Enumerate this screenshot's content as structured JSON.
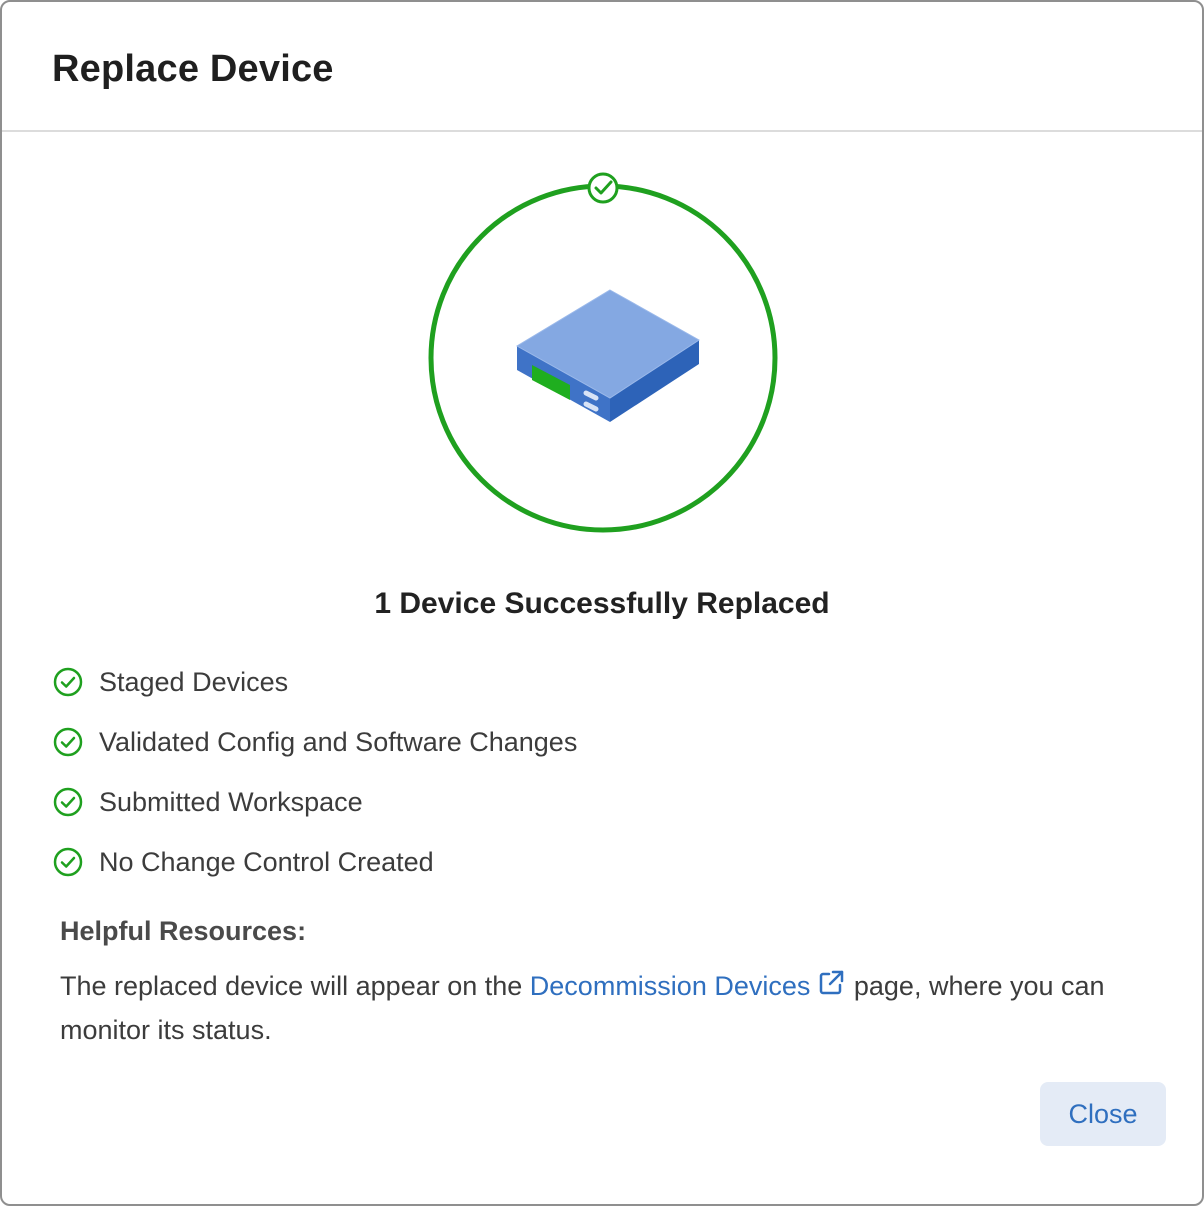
{
  "dialog": {
    "title": "Replace Device"
  },
  "status": {
    "headline": "1 Device Successfully Replaced",
    "ring_color": "#1fa01f"
  },
  "steps": [
    {
      "label": "Staged Devices",
      "icon": "check-circle-icon"
    },
    {
      "label": "Validated Config and Software Changes",
      "icon": "check-circle-icon"
    },
    {
      "label": "Submitted Workspace",
      "icon": "check-circle-icon"
    },
    {
      "label": "No Change Control Created",
      "icon": "check-circle-icon"
    }
  ],
  "resources": {
    "heading": "Helpful Resources:",
    "text_before": "The replaced device will appear on the ",
    "link_label": "Decommission Devices",
    "text_after": " page, where you can monitor its status."
  },
  "footer": {
    "close_label": "Close"
  },
  "colors": {
    "success": "#1fa01f",
    "link": "#2f6fbf",
    "device_top": "#84a8e2",
    "device_side": "#2d63b8"
  }
}
